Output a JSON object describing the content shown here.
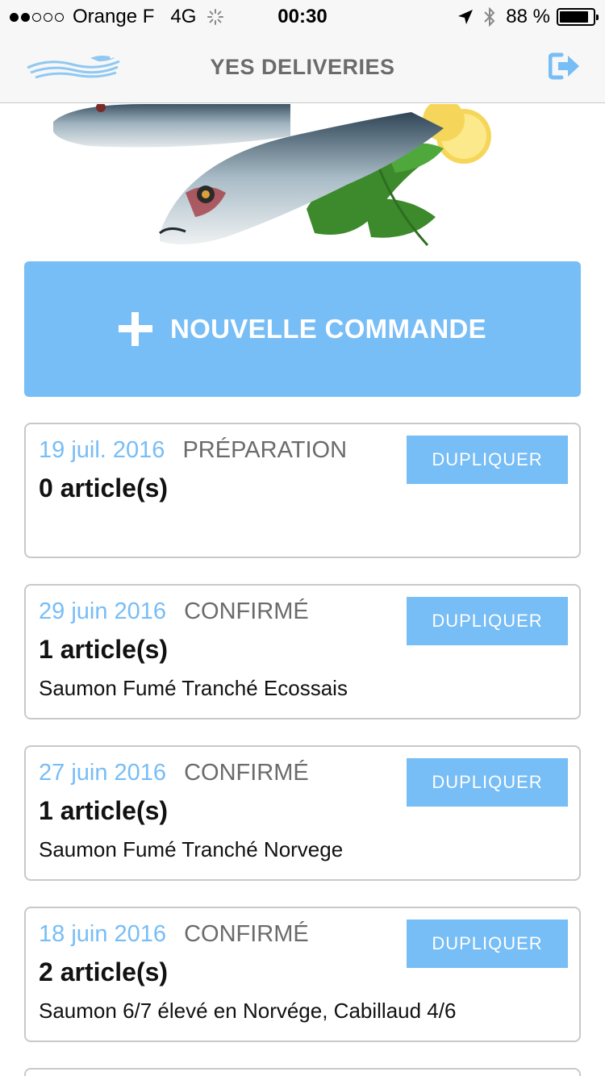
{
  "status_bar": {
    "carrier": "Orange F",
    "network": "4G",
    "time": "00:30",
    "battery_percent": "88 %",
    "battery_level": 0.88,
    "signal_bars_filled": 2,
    "signal_bars_total": 5
  },
  "nav": {
    "title": "YES DELIVERIES",
    "logo_icon": "fish-wave-logo",
    "logout_icon": "logout-icon"
  },
  "actions": {
    "new_order_label": "NOUVELLE COMMANDE"
  },
  "colors": {
    "accent": "#77bdf6",
    "status_gray": "#6b6b6b"
  },
  "orders": [
    {
      "date": "19 juil. 2016",
      "status": "PRÉPARATION",
      "count": "0 article(s)",
      "items": "",
      "duplicate_label": "DUPLIQUER"
    },
    {
      "date": "29 juin 2016",
      "status": "CONFIRMÉ",
      "count": "1 article(s)",
      "items": "Saumon Fumé Tranché Ecossais",
      "duplicate_label": "DUPLIQUER"
    },
    {
      "date": "27 juin 2016",
      "status": "CONFIRMÉ",
      "count": "1 article(s)",
      "items": "Saumon Fumé Tranché Norvege",
      "duplicate_label": "DUPLIQUER"
    },
    {
      "date": "18 juin 2016",
      "status": "CONFIRMÉ",
      "count": "2 article(s)",
      "items": "Saumon 6/7 élevé en Norvége, Cabillaud 4/6",
      "duplicate_label": "DUPLIQUER"
    }
  ]
}
